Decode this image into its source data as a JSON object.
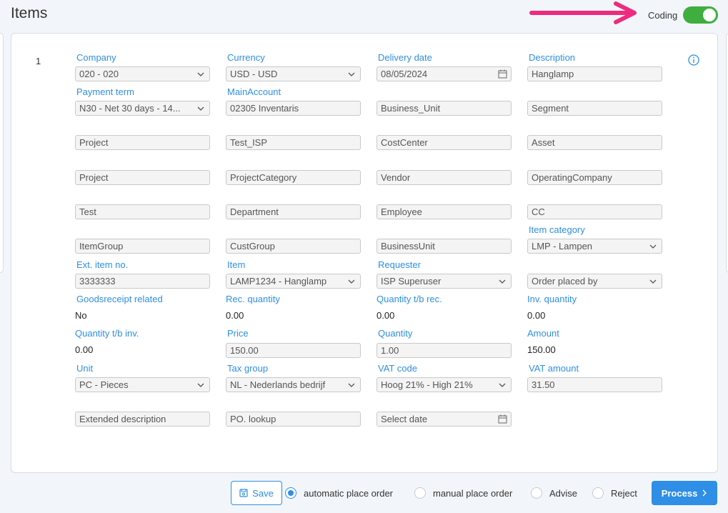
{
  "header": {
    "title": "Items",
    "coding_label": "Coding",
    "coding_on": true
  },
  "row_number": "1",
  "fields": {
    "company": {
      "label": "Company",
      "value": "020 - 020"
    },
    "currency": {
      "label": "Currency",
      "value": "USD - USD"
    },
    "delivery_date": {
      "label": "Delivery date",
      "value": "08/05/2024"
    },
    "description": {
      "label": "Description",
      "value": "Hanglamp"
    },
    "payment_term": {
      "label": "Payment term",
      "value": "N30 - Net 30 days - 14..."
    },
    "main_account": {
      "label": "MainAccount",
      "value": "02305 Inventaris"
    },
    "business_unit_1": {
      "placeholder": "Business_Unit"
    },
    "segment": {
      "placeholder": "Segment"
    },
    "project_1": {
      "placeholder": "Project"
    },
    "test_isp": {
      "placeholder": "Test_ISP"
    },
    "cost_center": {
      "placeholder": "CostCenter"
    },
    "asset": {
      "placeholder": "Asset"
    },
    "project_2": {
      "placeholder": "Project"
    },
    "project_category": {
      "placeholder": "ProjectCategory"
    },
    "vendor": {
      "placeholder": "Vendor"
    },
    "operating_company": {
      "placeholder": "OperatingCompany"
    },
    "test": {
      "placeholder": "Test"
    },
    "department": {
      "placeholder": "Department"
    },
    "employee": {
      "placeholder": "Employee"
    },
    "cc": {
      "placeholder": "CC"
    },
    "item_group": {
      "placeholder": "ItemGroup"
    },
    "cust_group": {
      "placeholder": "CustGroup"
    },
    "business_unit_2": {
      "placeholder": "BusinessUnit"
    },
    "item_category": {
      "label": "Item category",
      "value": "LMP - Lampen"
    },
    "ext_item_no": {
      "label": "Ext. item no.",
      "value": "3333333"
    },
    "item": {
      "label": "Item",
      "value": "LAMP1234 - Hanglamp"
    },
    "requester": {
      "label": "Requester",
      "value": "ISP Superuser"
    },
    "order_placed_by": {
      "placeholder": "Order placed by"
    },
    "goodsreceipt_related": {
      "label": "Goodsreceipt related",
      "value": "No"
    },
    "rec_quantity": {
      "label": "Rec. quantity",
      "value": "0.00"
    },
    "quantity_tb_rec": {
      "label": "Quantity t/b rec.",
      "value": "0.00"
    },
    "inv_quantity": {
      "label": "Inv. quantity",
      "value": "0.00"
    },
    "quantity_tb_inv": {
      "label": "Quantity t/b inv.",
      "value": "0.00"
    },
    "price": {
      "label": "Price",
      "value": "150.00"
    },
    "quantity": {
      "label": "Quantity",
      "value": "1.00"
    },
    "amount": {
      "label": "Amount",
      "value": "150.00"
    },
    "unit": {
      "label": "Unit",
      "value": "PC - Pieces"
    },
    "tax_group": {
      "label": "Tax group",
      "value": "NL - Nederlands bedrijf"
    },
    "vat_code": {
      "label": "VAT code",
      "value": "Hoog 21% - High 21%"
    },
    "vat_amount": {
      "label": "VAT amount",
      "value": "31.50"
    },
    "extended_description": {
      "placeholder": "Extended description"
    },
    "po_lookup": {
      "placeholder": "PO. lookup"
    },
    "select_date": {
      "placeholder": "Select date"
    }
  },
  "footer": {
    "save_label": "Save",
    "radio_options": [
      "automatic place order",
      "manual place order",
      "Advise",
      "Reject"
    ],
    "selected_option": "automatic place order",
    "process_label": "Process"
  },
  "colors": {
    "accent": "#2f8ee5",
    "toggle_on": "#3fae3f",
    "arrow": "#ee2b7e"
  }
}
